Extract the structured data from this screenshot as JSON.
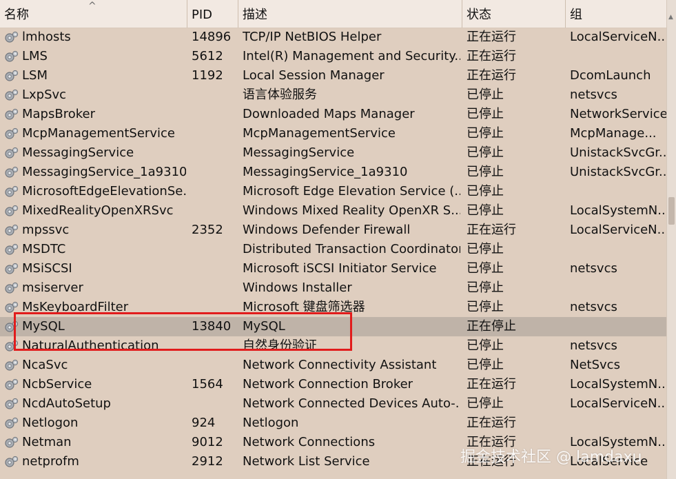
{
  "columns": {
    "name": "名称",
    "pid": "PID",
    "description": "描述",
    "status": "状态",
    "group": "组"
  },
  "services": [
    {
      "name": "lmhosts",
      "pid": "14896",
      "description": "TCP/IP NetBIOS Helper",
      "status": "正在运行",
      "group": "LocalServiceN..."
    },
    {
      "name": "LMS",
      "pid": "5612",
      "description": "Intel(R) Management and Security...",
      "status": "正在运行",
      "group": ""
    },
    {
      "name": "LSM",
      "pid": "1192",
      "description": "Local Session Manager",
      "status": "正在运行",
      "group": "DcomLaunch"
    },
    {
      "name": "LxpSvc",
      "pid": "",
      "description": "语言体验服务",
      "status": "已停止",
      "group": "netsvcs"
    },
    {
      "name": "MapsBroker",
      "pid": "",
      "description": "Downloaded Maps Manager",
      "status": "已停止",
      "group": "NetworkService"
    },
    {
      "name": "McpManagementService",
      "pid": "",
      "description": "McpManagementService",
      "status": "已停止",
      "group": "McpManage..."
    },
    {
      "name": "MessagingService",
      "pid": "",
      "description": "MessagingService",
      "status": "已停止",
      "group": "UnistackSvcGr..."
    },
    {
      "name": "MessagingService_1a9310",
      "pid": "",
      "description": "MessagingService_1a9310",
      "status": "已停止",
      "group": "UnistackSvcGr..."
    },
    {
      "name": "MicrosoftEdgeElevationSe...",
      "pid": "",
      "description": "Microsoft Edge Elevation Service (...",
      "status": "已停止",
      "group": ""
    },
    {
      "name": "MixedRealityOpenXRSvc",
      "pid": "",
      "description": "Windows Mixed Reality OpenXR S...",
      "status": "已停止",
      "group": "LocalSystemN..."
    },
    {
      "name": "mpssvc",
      "pid": "2352",
      "description": "Windows Defender Firewall",
      "status": "正在运行",
      "group": "LocalServiceN..."
    },
    {
      "name": "MSDTC",
      "pid": "",
      "description": "Distributed Transaction Coordinator",
      "status": "已停止",
      "group": ""
    },
    {
      "name": "MSiSCSI",
      "pid": "",
      "description": "Microsoft iSCSI Initiator Service",
      "status": "已停止",
      "group": "netsvcs"
    },
    {
      "name": "msiserver",
      "pid": "",
      "description": "Windows Installer",
      "status": "已停止",
      "group": ""
    },
    {
      "name": "MsKeyboardFilter",
      "pid": "",
      "description": "Microsoft 键盘筛选器",
      "status": "已停止",
      "group": "netsvcs"
    },
    {
      "name": "MySQL",
      "pid": "13840",
      "description": "MySQL",
      "status": "正在停止",
      "group": "",
      "selected": true
    },
    {
      "name": "NaturalAuthentication",
      "pid": "",
      "description": "自然身份验证",
      "status": "已停止",
      "group": "netsvcs"
    },
    {
      "name": "NcaSvc",
      "pid": "",
      "description": "Network Connectivity Assistant",
      "status": "已停止",
      "group": "NetSvcs"
    },
    {
      "name": "NcbService",
      "pid": "1564",
      "description": "Network Connection Broker",
      "status": "正在运行",
      "group": "LocalSystemN..."
    },
    {
      "name": "NcdAutoSetup",
      "pid": "",
      "description": "Network Connected Devices Auto-...",
      "status": "已停止",
      "group": "LocalServiceN..."
    },
    {
      "name": "Netlogon",
      "pid": "924",
      "description": "Netlogon",
      "status": "正在运行",
      "group": ""
    },
    {
      "name": "Netman",
      "pid": "9012",
      "description": "Network Connections",
      "status": "正在运行",
      "group": "LocalSystemN..."
    },
    {
      "name": "netprofm",
      "pid": "2912",
      "description": "Network List Service",
      "status": "正在运行",
      "group": "LocalService"
    }
  ],
  "watermark": "掘金技术社区 @ lamdaxu",
  "colors": {
    "highlight": "#e11c1c",
    "selected_row": "#bfb3a8",
    "background": "#dfcebf"
  }
}
